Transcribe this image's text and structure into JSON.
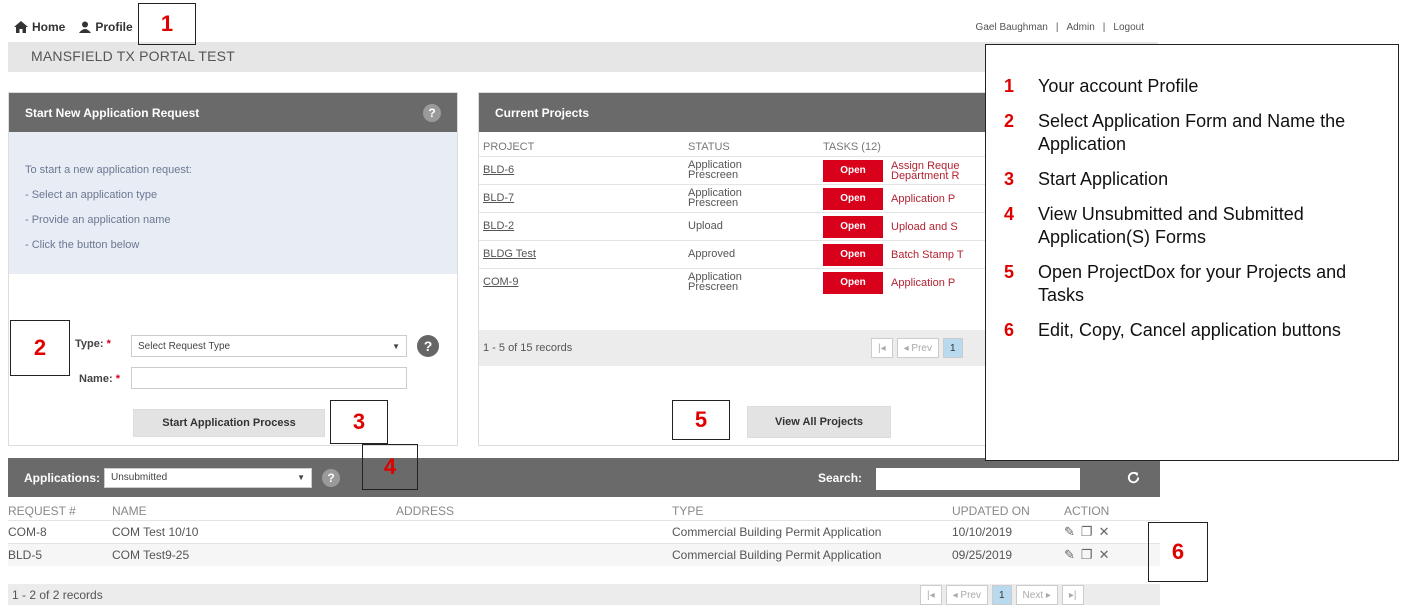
{
  "topnav": {
    "home": "Home",
    "profile": "Profile"
  },
  "user": {
    "name": "Gael Baughman",
    "admin": "Admin",
    "logout": "Logout"
  },
  "portal_title": "MANSFIELD TX PORTAL TEST",
  "new_app": {
    "title": "Start New Application Request",
    "help": "?",
    "instructions": [
      "To start a new application request:",
      "- Select an application type",
      "- Provide an application name",
      "- Click the button below"
    ],
    "type_label": "Type:",
    "type_placeholder": "Select Request Type",
    "name_label": "Name:",
    "required_mark": "*",
    "start_button": "Start Application Process"
  },
  "projects": {
    "title": "Current Projects",
    "col_project": "PROJECT",
    "col_status": "STATUS",
    "col_tasks": "TASKS (12)",
    "open_label": "Open",
    "rows": [
      {
        "project": "BLD-6",
        "status1": "Application",
        "status2": "Prescreen",
        "task1": "Assign Reque",
        "task2": "Department R"
      },
      {
        "project": "BLD-7",
        "status1": "Application",
        "status2": "Prescreen",
        "task1": "Application P",
        "task2": ""
      },
      {
        "project": "BLD-2",
        "status1": "Upload",
        "status2": "",
        "task1": "Upload and S",
        "task2": ""
      },
      {
        "project": "BLDG Test",
        "status1": "Approved",
        "status2": "",
        "task1": "Batch Stamp T",
        "task2": ""
      },
      {
        "project": "COM-9",
        "status1": "Application",
        "status2": "Prescreen",
        "task1": "Application P",
        "task2": ""
      }
    ],
    "records": "1 - 5 of 15 records",
    "prev": "◂ Prev",
    "page": "1",
    "view_all": "View All Projects"
  },
  "apps": {
    "label": "Applications:",
    "filter": "Unsubmitted",
    "help": "?",
    "search_label": "Search:",
    "columns": [
      "REQUEST #",
      "NAME",
      "ADDRESS",
      "TYPE",
      "UPDATED ON",
      "ACTION"
    ],
    "rows": [
      {
        "req": "COM-8",
        "name": "COM Test 10/10",
        "address": "",
        "type": "Commercial Building Permit Application",
        "updated": "10/10/2019"
      },
      {
        "req": "BLD-5",
        "name": "COM Test9-25",
        "address": "",
        "type": "Commercial Building Permit Application",
        "updated": "09/25/2019"
      }
    ],
    "records": "1 - 2 of 2 records",
    "prev": "◂ Prev",
    "page": "1",
    "next": "Next ▸"
  },
  "callouts": [
    "1",
    "2",
    "3",
    "4",
    "5",
    "6"
  ],
  "legend": [
    {
      "num": "1",
      "text": "Your account Profile"
    },
    {
      "num": "2",
      "text": "Select Application Form and Name the Application"
    },
    {
      "num": "3",
      "text": "Start Application"
    },
    {
      "num": "4",
      "text": "View Unsubmitted and Submitted Application(S) Forms"
    },
    {
      "num": "5",
      "text": "Open ProjectDox for your Projects and Tasks"
    },
    {
      "num": "6",
      "text": "Edit, Copy, Cancel application buttons"
    }
  ],
  "icons": {
    "home": "home-icon",
    "profile": "user-icon",
    "refresh": "refresh-icon",
    "edit": "edit-icon",
    "copy": "copy-icon",
    "cancel": "close-icon"
  },
  "colors": {
    "header_gray": "#6a6a6a",
    "open_red": "#d9001b",
    "callout_red": "#e00000"
  }
}
